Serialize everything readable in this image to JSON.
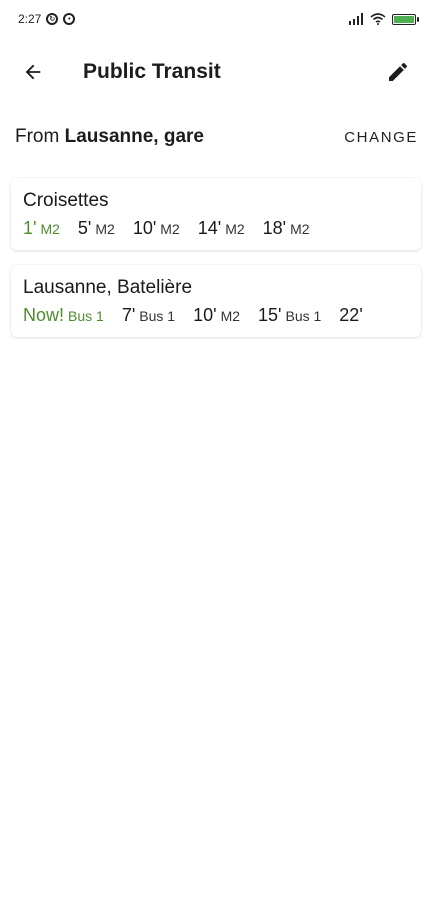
{
  "statusbar": {
    "time": "2:27",
    "left_icons": [
      "sync-icon",
      "notification-icon"
    ],
    "right_icons": [
      "signal-icon",
      "wifi-icon",
      "battery-icon"
    ]
  },
  "appbar": {
    "title": "Public Transit",
    "back_icon": "arrow-back-icon",
    "edit_icon": "pencil-icon"
  },
  "from": {
    "prefix": "From",
    "station": "Lausanne, gare",
    "change_label": "CHANGE"
  },
  "stops": [
    {
      "name": "Croisettes",
      "departures": [
        {
          "time": "1'",
          "line": "M2",
          "highlight": true
        },
        {
          "time": "5'",
          "line": "M2",
          "highlight": false
        },
        {
          "time": "10'",
          "line": "M2",
          "highlight": false
        },
        {
          "time": "14'",
          "line": "M2",
          "highlight": false
        },
        {
          "time": "18'",
          "line": "M2",
          "highlight": false
        }
      ]
    },
    {
      "name": "Lausanne, Batelière",
      "departures": [
        {
          "time": "Now!",
          "line": "Bus 1",
          "highlight": true
        },
        {
          "time": "7'",
          "line": "Bus 1",
          "highlight": false
        },
        {
          "time": "10'",
          "line": "M2",
          "highlight": false
        },
        {
          "time": "15'",
          "line": "Bus 1",
          "highlight": false
        },
        {
          "time": "22'",
          "line": "",
          "highlight": false
        }
      ]
    }
  ],
  "colors": {
    "highlight": "#4e8c2e",
    "text": "#1a1a1a",
    "background": "#ffffff"
  }
}
